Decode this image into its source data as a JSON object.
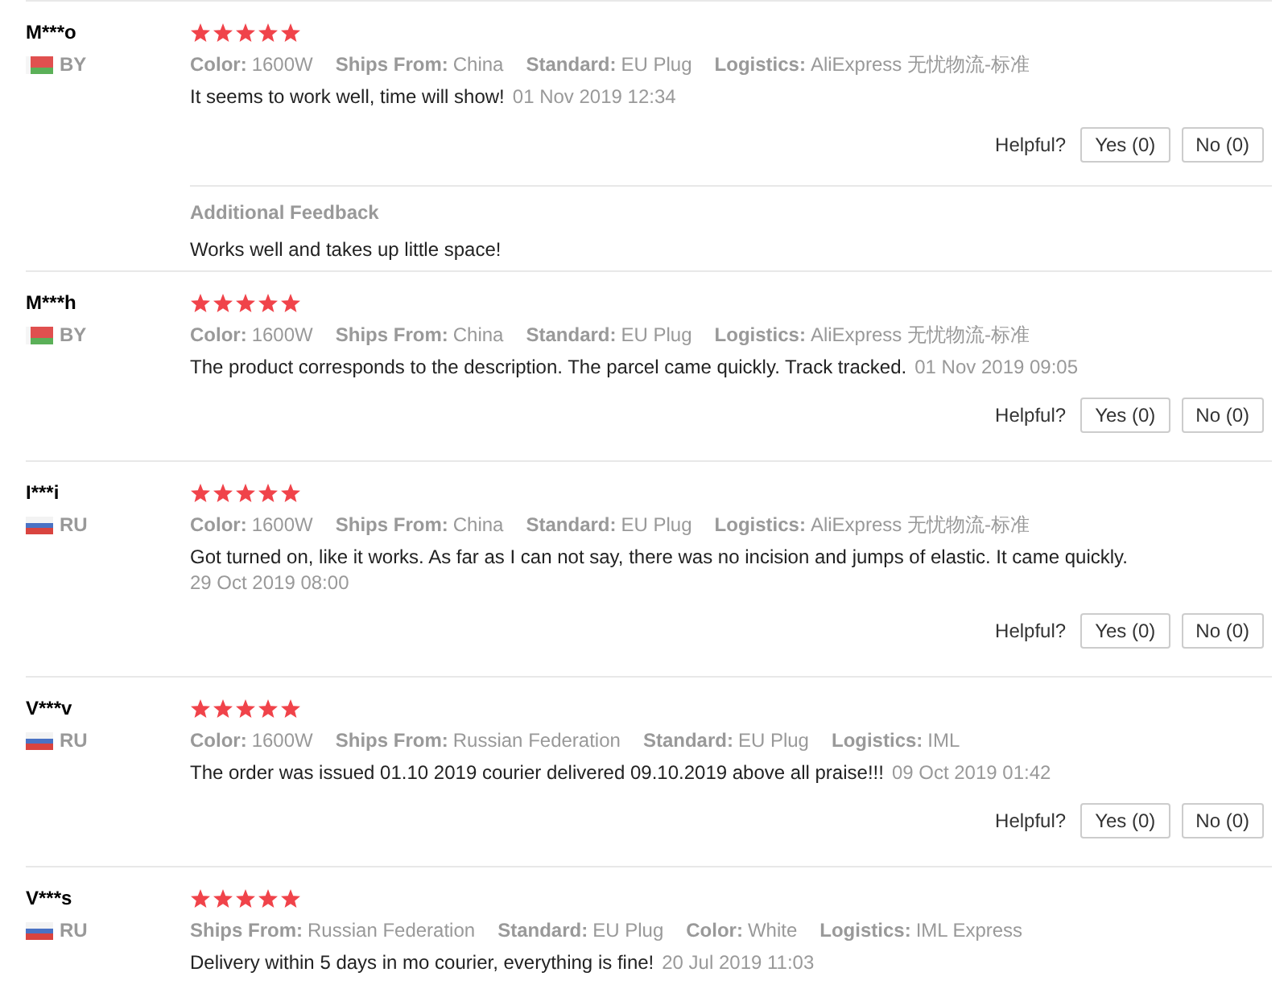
{
  "reviews": [
    {
      "name": "M***o",
      "kind": "belarus",
      "country": "BY",
      "stars": 5,
      "attributes": [
        {
          "label": "Color:",
          "value": "1600W"
        },
        {
          "label": "Ships From:",
          "value": "China"
        },
        {
          "label": "Standard:",
          "value": "EU Plug"
        },
        {
          "label": "Logistics:",
          "value": "AliExpress 无忧物流-标准"
        }
      ],
      "text": "It seems to work well, time will show!",
      "date": "01 Nov 2019 12:34",
      "helpful": {
        "label": "Helpful?",
        "yes": "Yes (0)",
        "no": "No (0)"
      },
      "additional_feedback": {
        "title": "Additional Feedback",
        "text": "Works well and takes up little space!"
      }
    },
    {
      "name": "M***h",
      "kind": "belarus",
      "country": "BY",
      "stars": 5,
      "attributes": [
        {
          "label": "Color:",
          "value": "1600W"
        },
        {
          "label": "Ships From:",
          "value": "China"
        },
        {
          "label": "Standard:",
          "value": "EU Plug"
        },
        {
          "label": "Logistics:",
          "value": "AliExpress 无忧物流-标准"
        }
      ],
      "text": "The product corresponds to the description. The parcel came quickly. Track tracked.",
      "date": "01 Nov 2019 09:05",
      "helpful": {
        "label": "Helpful?",
        "yes": "Yes (0)",
        "no": "No (0)"
      }
    },
    {
      "name": "I***i",
      "kind": "russia",
      "country": "RU",
      "stars": 5,
      "attributes": [
        {
          "label": "Color:",
          "value": "1600W"
        },
        {
          "label": "Ships From:",
          "value": "China"
        },
        {
          "label": "Standard:",
          "value": "EU Plug"
        },
        {
          "label": "Logistics:",
          "value": "AliExpress 无忧物流-标准"
        }
      ],
      "text": "Got turned on, like it works. As far as I can not say, there was no incision and jumps of elastic. It came quickly.",
      "date": "29 Oct 2019 08:00",
      "helpful": {
        "label": "Helpful?",
        "yes": "Yes (0)",
        "no": "No (0)"
      }
    },
    {
      "name": "V***v",
      "kind": "russia",
      "country": "RU",
      "stars": 5,
      "attributes": [
        {
          "label": "Color:",
          "value": "1600W"
        },
        {
          "label": "Ships From:",
          "value": "Russian Federation"
        },
        {
          "label": "Standard:",
          "value": "EU Plug"
        },
        {
          "label": "Logistics:",
          "value": "IML"
        }
      ],
      "text": "The order was issued 01.10 2019 courier delivered 09.10.2019 above all praise!!!",
      "date": "09 Oct 2019 01:42",
      "helpful": {
        "label": "Helpful?",
        "yes": "Yes (0)",
        "no": "No (0)"
      }
    },
    {
      "name": "V***s",
      "kind": "russia",
      "country": "RU",
      "stars": 5,
      "attributes": [
        {
          "label": "Ships From:",
          "value": "Russian Federation"
        },
        {
          "label": "Standard:",
          "value": "EU Plug"
        },
        {
          "label": "Color:",
          "value": "White"
        },
        {
          "label": "Logistics:",
          "value": "IML Express"
        }
      ],
      "text": "Delivery within 5 days in mo courier, everything is fine!",
      "date": "20 Jul 2019 11:03"
    }
  ]
}
